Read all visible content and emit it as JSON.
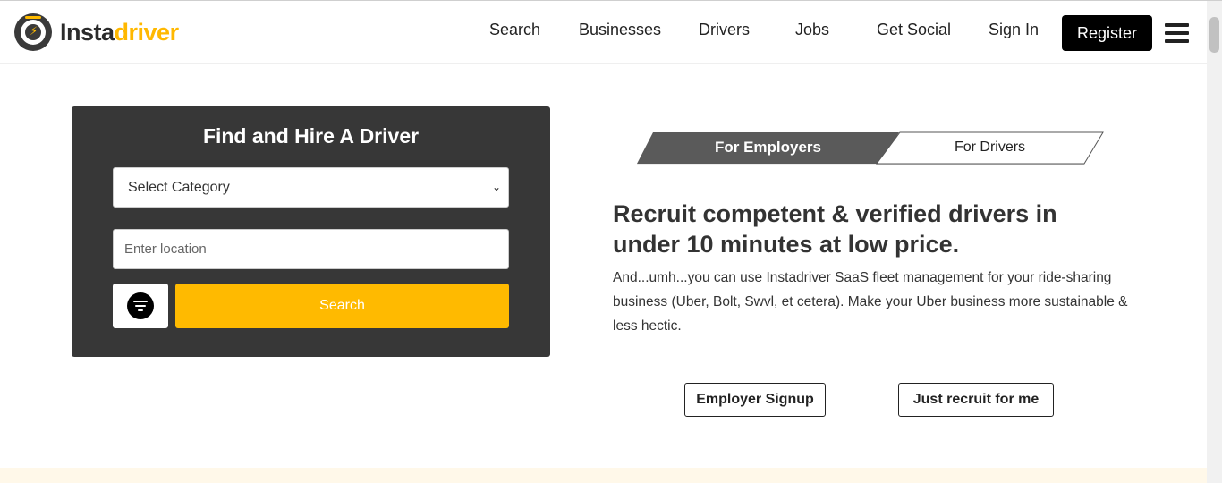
{
  "brand": {
    "part1": "Insta",
    "part2": "driver",
    "accent": "#ffb800"
  },
  "nav": {
    "items": [
      "Search",
      "Businesses",
      "Drivers",
      "Jobs",
      "Get Social",
      "Sign In"
    ],
    "register_label": "Register"
  },
  "search_card": {
    "title": "Find and Hire A Driver",
    "category_selected": "Select Category",
    "location_placeholder": "Enter location",
    "search_label": "Search",
    "button_color": "#ffba00"
  },
  "tabs": {
    "employers": "For Employers",
    "drivers": "For Drivers",
    "active": "employers"
  },
  "hero": {
    "headline": "Recruit competent & verified drivers in under 10 minutes at low price.",
    "paragraph": "And...umh...you can use Instadriver SaaS fleet management for your ride-sharing business (Uber, Bolt, Swvl, et cetera). Make your Uber business more sustainable & less hectic."
  },
  "actions": {
    "employer_signup": "Employer Signup",
    "recruit": "Just recruit for me"
  }
}
